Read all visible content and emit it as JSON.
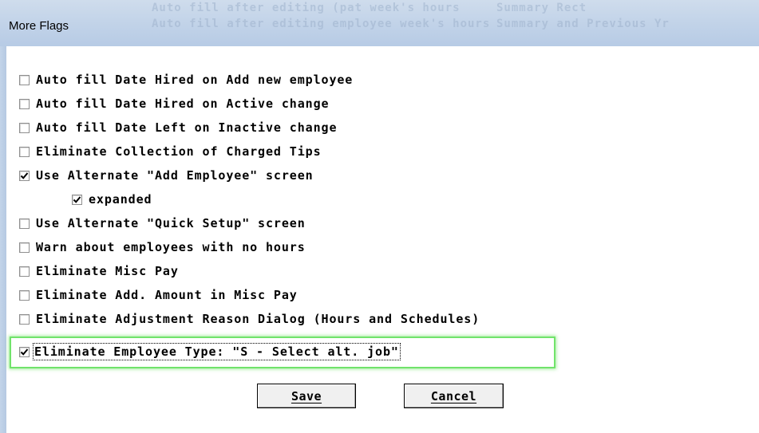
{
  "window": {
    "title": "More Flags",
    "background_text": [
      "Auto fill after editing (pat week's hours",
      "Auto fill after editing employee week's hours",
      "Summary Rect",
      "Summary and Previous Yr"
    ]
  },
  "options": [
    {
      "label": "Auto fill Date Hired on Add new employee",
      "checked": false
    },
    {
      "label": "Auto fill Date Hired on Active change",
      "checked": false
    },
    {
      "label": "Auto fill Date Left on Inactive change",
      "checked": false
    },
    {
      "label": "Eliminate Collection of Charged Tips",
      "checked": false
    },
    {
      "label": "Use Alternate \"Add Employee\" screen",
      "checked": true
    },
    {
      "label": "expanded",
      "checked": true
    },
    {
      "label": "Use Alternate \"Quick Setup\" screen",
      "checked": false
    },
    {
      "label": "Warn about employees with no hours",
      "checked": false
    },
    {
      "label": "Eliminate Misc Pay",
      "checked": false
    },
    {
      "label": "Eliminate Add. Amount in Misc Pay",
      "checked": false
    },
    {
      "label": "Eliminate Adjustment Reason Dialog (Hours and Schedules)",
      "checked": false
    },
    {
      "label": "Eliminate Employee Type: \"S - Select alt. job\"",
      "checked": true,
      "focused": true,
      "highlighted": true
    }
  ],
  "buttons": {
    "save": "Save",
    "cancel": "Cancel"
  },
  "colors": {
    "titlebar": "#c3d4e9",
    "highlight_border": "#71e36b",
    "client_bg": "#ffffff"
  }
}
